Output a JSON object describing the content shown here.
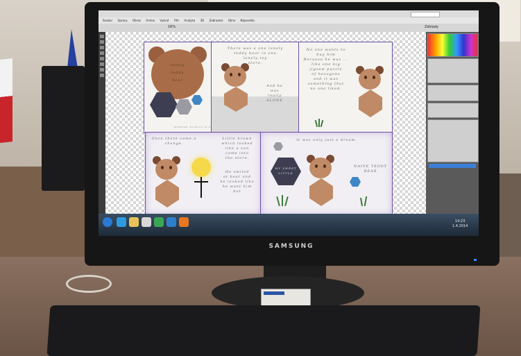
{
  "app": {
    "menu": [
      "Soubor",
      "Úpravy",
      "Obraz",
      "Vrstva",
      "Vybrat",
      "Filtr",
      "Analýza",
      "3D",
      "Zobrazení",
      "Okno",
      "Nápověda"
    ],
    "zoom": "16%",
    "workspace": "Základy"
  },
  "artwork": {
    "panel1": {
      "title": "lonely\nteddy\nbear",
      "credit": "Kristina Tvrdová  II.A"
    },
    "panel2": {
      "text_top": "There was a one lonely\nteddy bear in one\nlonely toy\nstore.",
      "text_bottom": "And he\nwas\nreally\nALONE"
    },
    "panel3": {
      "text": "No one wants to buy him\nBecause he was ...\nlike one big\njigsaw puzzle\nof hexagons\nand it was\nsomething that\nno one liked."
    },
    "panel4": {
      "text_left": "Once there came a\nchange.",
      "text_right": "Little brown\nwhich looked\nlike a sun\ncame into\nthe store.",
      "text_right2": "He smiled\nat bear and\nhe looked like\nhe want him\nbut"
    },
    "panel5": {
      "text_top": "It was only just a dream.",
      "hex_label": "MY SWEET\nLITTLE",
      "text_right": "NAIVE TEDDY\nBEAR"
    }
  },
  "monitor": {
    "brand": "SAMSUNG"
  },
  "taskbar": {
    "time": "14:23",
    "date": "1.4.2014"
  },
  "colors": {
    "bear": "#c08a66",
    "ear": "#7a4a32",
    "hex_dark": "#3e3e52",
    "hex_blue": "#3f86c4",
    "sun": "#f5d94a"
  }
}
